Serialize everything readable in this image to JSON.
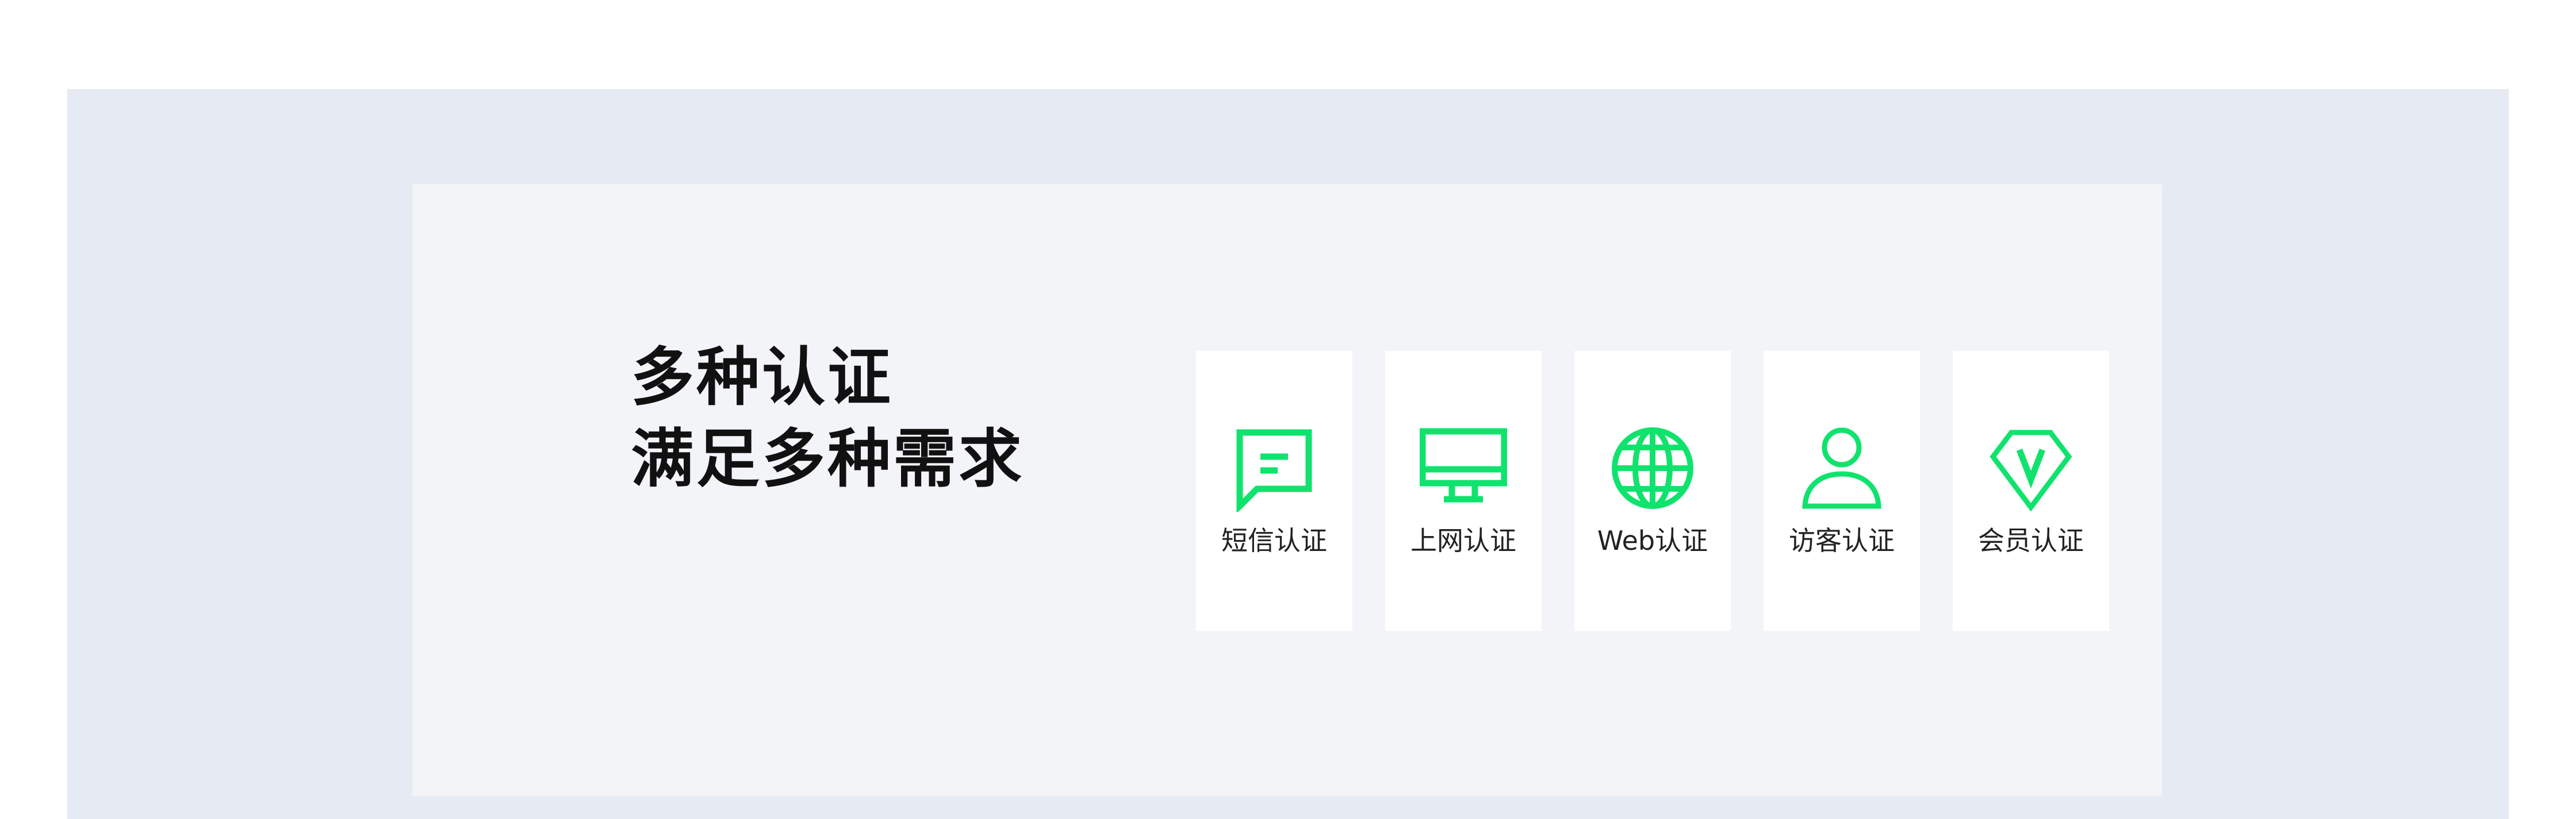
{
  "headline": {
    "line1": "多种认证",
    "line2": "满足多种需求"
  },
  "accent_color": "#10e36d",
  "cards": [
    {
      "label": "短信认证",
      "icon": "sms-message-icon"
    },
    {
      "label": "上网认证",
      "icon": "monitor-icon"
    },
    {
      "label": "Web认证",
      "icon": "globe-icon"
    },
    {
      "label": "访客认证",
      "icon": "user-icon"
    },
    {
      "label": "会员认证",
      "icon": "vip-diamond-icon"
    }
  ]
}
